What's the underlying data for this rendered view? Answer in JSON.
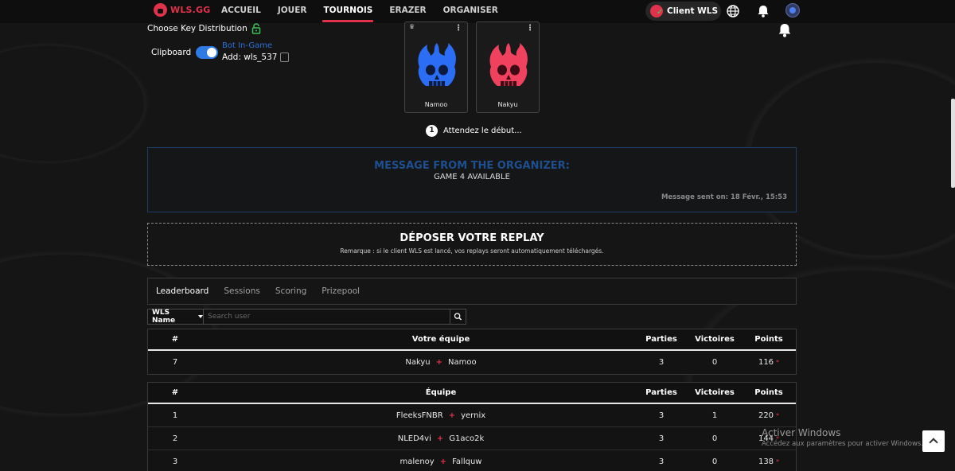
{
  "nav": {
    "logo_text": "WLS.GG",
    "links": [
      "ACCUEIL",
      "JOUER",
      "TOURNOIS",
      "ERAZER",
      "ORGANISER"
    ],
    "active_link": "TOURNOIS",
    "client_label": "Client WLS",
    "icons": [
      "globe-icon",
      "bell-icon",
      "avatar"
    ]
  },
  "key_distribution": {
    "title": "Choose Key Distribution",
    "clipboard_label": "Clipboard",
    "clipboard_enabled": true,
    "bot_label": "Bot In-Game",
    "add_label": "Add: wls_537"
  },
  "players": [
    {
      "name": "Namoo",
      "color": "#2b6ef5"
    },
    {
      "name": "Nakyu",
      "color": "#f0425f"
    }
  ],
  "waiting": {
    "step": "1",
    "text": "Attendez le début..."
  },
  "organizer": {
    "title": "MESSAGE FROM THE ORGANIZER:",
    "message": "GAME 4 AVAILABLE",
    "sent": "Message sent on: 18 Févr., 15:53"
  },
  "replay": {
    "title": "DÉPOSER VOTRE REPLAY",
    "note": "Remarque : si le client WLS est lancé, vos replays seront automatiquement téléchargés."
  },
  "tabs": [
    "Leaderboard",
    "Sessions",
    "Scoring",
    "Prizepool"
  ],
  "active_tab": "Leaderboard",
  "search": {
    "select_label": "WLS Name",
    "placeholder": "Search user"
  },
  "my_team_table": {
    "headers": [
      "#",
      "Votre équipe",
      "Parties",
      "Victoires",
      "Points"
    ],
    "rows": [
      {
        "rank": "7",
        "p1": "Nakyu",
        "p2": "Namoo",
        "parties": "3",
        "victoires": "0",
        "points": "116"
      }
    ]
  },
  "team_table": {
    "headers": [
      "#",
      "Équipe",
      "Parties",
      "Victoires",
      "Points"
    ],
    "rows": [
      {
        "rank": "1",
        "p1": "FleeksFNBR",
        "p2": "yernix",
        "parties": "3",
        "victoires": "1",
        "points": "220"
      },
      {
        "rank": "2",
        "p1": "NLED4vi",
        "p2": "G1aco2k",
        "parties": "3",
        "victoires": "0",
        "points": "144"
      },
      {
        "rank": "3",
        "p1": "malenoy",
        "p2": "Fallquw",
        "parties": "3",
        "victoires": "0",
        "points": "138"
      }
    ]
  },
  "watermark": {
    "title": "Activer Windows",
    "subtitle": "Accédez aux paramètres pour activer Windows."
  },
  "colors": {
    "accent": "#e0334b",
    "link_blue": "#2e6fd6",
    "org_title": "#1f4f8f"
  }
}
